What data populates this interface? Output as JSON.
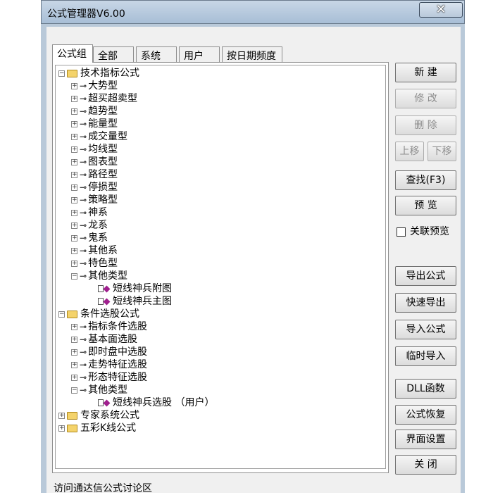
{
  "window": {
    "title": "公式管理器V6.00",
    "close_glyph": "✕"
  },
  "tabs": [
    {
      "label": "公式组",
      "active": true
    },
    {
      "label": "全部"
    },
    {
      "label": "系统"
    },
    {
      "label": "用户"
    },
    {
      "label": "按日期频度"
    }
  ],
  "tree": {
    "group1": {
      "label": "技术指标公式"
    },
    "group1_items": [
      "大势型",
      "超买超卖型",
      "趋势型",
      "能量型",
      "成交量型",
      "均线型",
      "图表型",
      "路径型",
      "停损型",
      "策略型",
      "神系",
      "龙系",
      "鬼系",
      "其他系",
      "特色型",
      "其他类型"
    ],
    "group1_leaves": [
      "短线神兵附图",
      "短线神兵主图"
    ],
    "group2": {
      "label": "条件选股公式"
    },
    "group2_items": [
      "指标条件选股",
      "基本面选股",
      "即时盘中选股",
      "走势特征选股",
      "形态特征选股",
      "其他类型"
    ],
    "group2_leaves": [
      "短线神兵选股  （用户）"
    ],
    "group3": {
      "label": "专家系统公式"
    },
    "group4": {
      "label": "五彩K线公式"
    }
  },
  "buttons": {
    "new": "新  建",
    "edit": "修  改",
    "delete": "删  除",
    "move_up": "上移",
    "move_down": "下移",
    "find": "查找(F3)",
    "preview": "预  览",
    "export": "导出公式",
    "quick_export": "快速导出",
    "import": "导入公式",
    "temp_import": "临时导入",
    "dll": "DLL函数",
    "restore": "公式恢复",
    "ui_settings": "界面设置",
    "close": "关  闭"
  },
  "checkbox": {
    "label": "关联预览",
    "checked": false
  },
  "status_text": "访问通达信公式讨论区"
}
